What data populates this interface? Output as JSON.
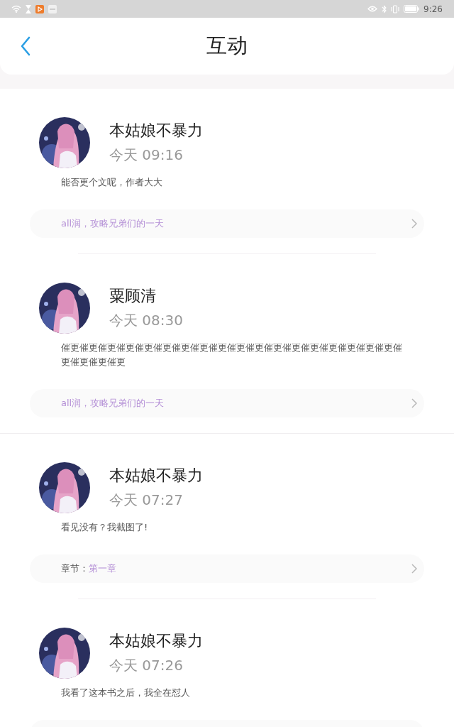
{
  "status_bar": {
    "time": "9:26"
  },
  "header": {
    "title": "互动"
  },
  "sections": [
    {
      "items": [
        {
          "name": "本姑娘不暴力",
          "time": "今天 09:16",
          "comment": "能否更个文呢，作者大大",
          "ref": {
            "kind": "book",
            "title": "all润，攻略兄弟们的一天"
          }
        },
        {
          "name": "粟顾清",
          "time": "今天 08:30",
          "comment": "催更催更催更催更催更催更催更催更催更催更催更催更催更催更催更催更催更催更催更催更催更催更",
          "ref": {
            "kind": "book",
            "title": "all润，攻略兄弟们的一天"
          }
        }
      ]
    },
    {
      "items": [
        {
          "name": "本姑娘不暴力",
          "time": "今天 07:27",
          "comment": "看见没有？我截图了!",
          "ref": {
            "kind": "chapter",
            "label": "章节：",
            "title": "第一章"
          }
        },
        {
          "name": "本姑娘不暴力",
          "time": "今天 07:26",
          "comment": "我看了这本书之后，我全在怼人",
          "ref": {
            "kind": "cut"
          }
        }
      ]
    }
  ]
}
